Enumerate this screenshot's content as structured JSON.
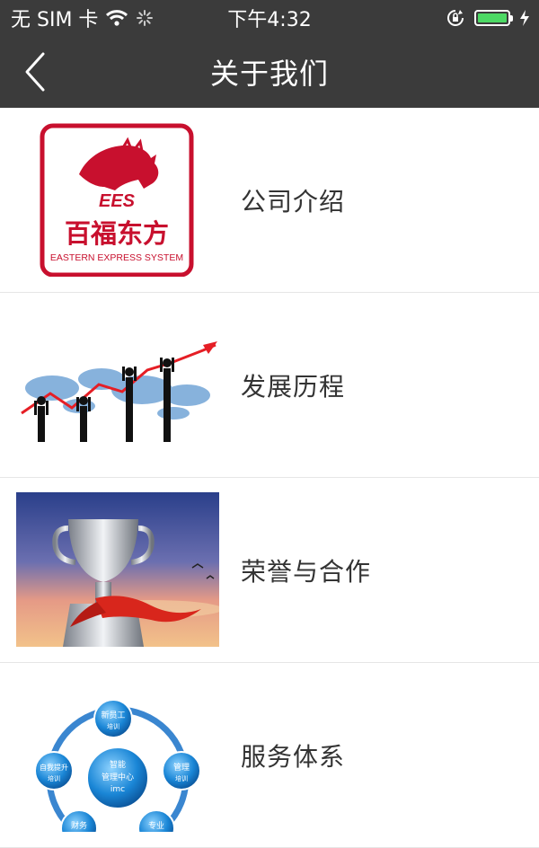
{
  "status_bar": {
    "carrier": "无 SIM 卡",
    "time": "下午4:32",
    "battery_level": 1.0,
    "colors": {
      "battery_fill": "#4cd964",
      "bar_bg": "#3b3b3b"
    }
  },
  "nav": {
    "title": "关于我们",
    "back_icon": "chevron-left-icon"
  },
  "items": [
    {
      "label": "公司介绍",
      "image": "ees-logo",
      "logo": {
        "brand": "EES",
        "name_cn": "百福东方",
        "name_en": "EASTERN EXPRESS SYSTEM"
      }
    },
    {
      "label": "发展历程",
      "image": "growth-chart-illustration"
    },
    {
      "label": "荣誉与合作",
      "image": "trophy-illustration"
    },
    {
      "label": "服务体系",
      "image": "service-system-diagram",
      "diagram": {
        "center": [
          "智能",
          "管理中心",
          "imc"
        ],
        "nodes": [
          {
            "title": "新员工",
            "sub": "培训"
          },
          {
            "title": "管理",
            "sub": "培训"
          },
          {
            "title": "自我提升",
            "sub": "培训"
          },
          {
            "title": "专业",
            "sub": ""
          },
          {
            "title": "财务",
            "sub": ""
          }
        ]
      }
    }
  ]
}
